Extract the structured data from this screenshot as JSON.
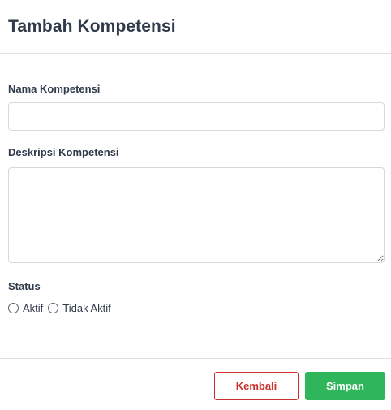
{
  "modal": {
    "title": "Tambah Kompetensi"
  },
  "form": {
    "nama": {
      "label": "Nama Kompetensi",
      "value": "",
      "placeholder": ""
    },
    "deskripsi": {
      "label": "Deskripsi Kompetensi",
      "value": "",
      "placeholder": ""
    },
    "status": {
      "label": "Status",
      "options": [
        "Aktif",
        "Tidak Aktif"
      ],
      "selected": null
    }
  },
  "footer": {
    "back_label": "Kembali",
    "save_label": "Simpan"
  },
  "colors": {
    "text": "#2f3a4a",
    "border": "#d5d9de",
    "danger": "#c9302c",
    "success": "#2fb55a"
  }
}
